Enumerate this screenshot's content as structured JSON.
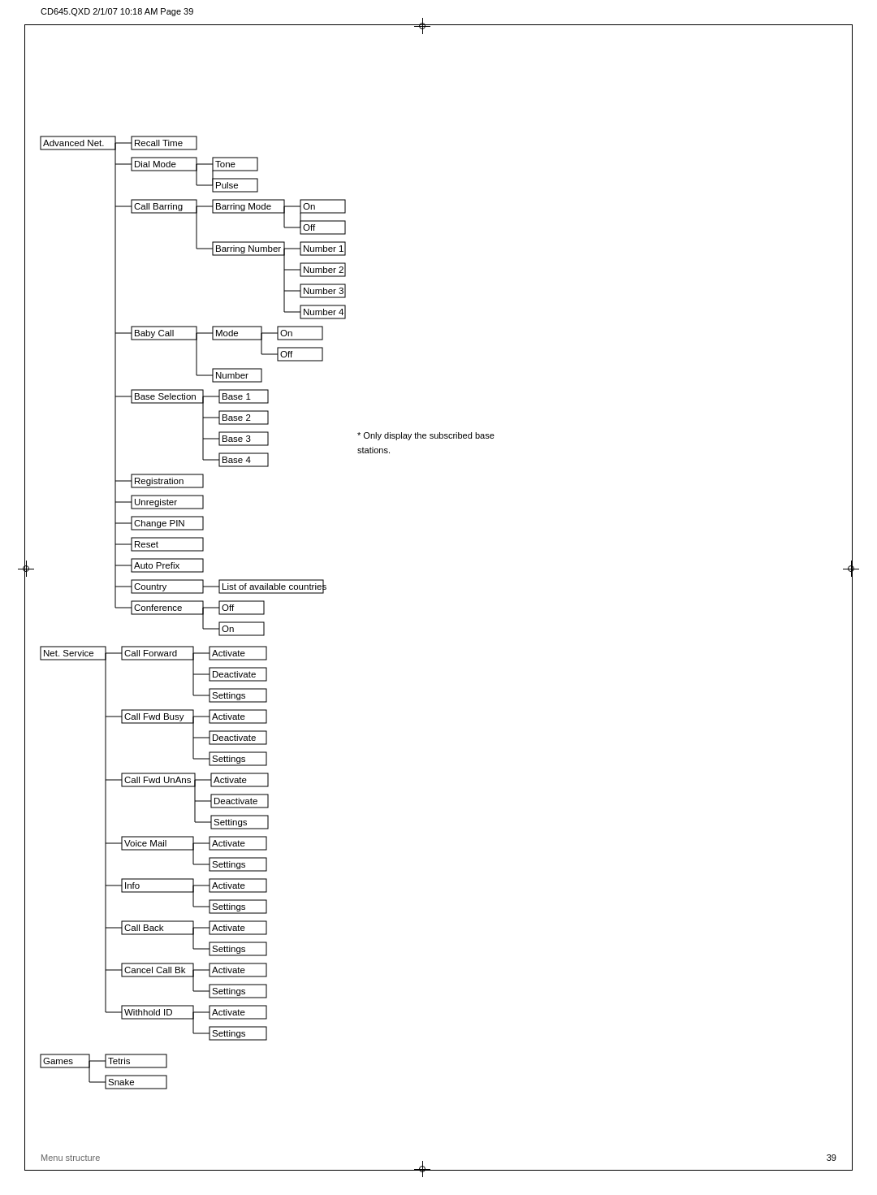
{
  "header": {
    "text": "CD645.QXD   2/1/07   10:18 AM   Page  39"
  },
  "footer": {
    "label": "Menu structure",
    "page_number": "39"
  },
  "note": "* Only display the subscribed base stations.",
  "tree": {
    "root1": {
      "label": "Advanced Net.",
      "children": [
        {
          "label": "Recall Time"
        },
        {
          "label": "Dial Mode",
          "children": [
            {
              "label": "Tone"
            },
            {
              "label": "Pulse"
            }
          ]
        },
        {
          "label": "Call Barring",
          "children": [
            {
              "label": "Barring Mode",
              "children": [
                {
                  "label": "On"
                },
                {
                  "label": "Off"
                }
              ]
            },
            {
              "label": "Barring Number",
              "children": [
                {
                  "label": "Number 1"
                },
                {
                  "label": "Number 2"
                },
                {
                  "label": "Number 3"
                },
                {
                  "label": "Number 4"
                }
              ]
            }
          ]
        },
        {
          "label": "Baby Call",
          "children": [
            {
              "label": "Mode",
              "children": [
                {
                  "label": "On"
                },
                {
                  "label": "Off"
                }
              ]
            },
            {
              "label": "Number"
            }
          ]
        },
        {
          "label": "Base Selection",
          "children": [
            {
              "label": "Base 1"
            },
            {
              "label": "Base 2"
            },
            {
              "label": "Base 3"
            },
            {
              "label": "Base 4"
            }
          ]
        },
        {
          "label": "Registration"
        },
        {
          "label": "Unregister"
        },
        {
          "label": "Change PIN"
        },
        {
          "label": "Reset"
        },
        {
          "label": "Auto Prefix"
        },
        {
          "label": "Country",
          "children": [
            {
              "label": "List of available countries"
            }
          ]
        },
        {
          "label": "Conference",
          "children": [
            {
              "label": "Off"
            },
            {
              "label": "On"
            }
          ]
        }
      ]
    },
    "root2": {
      "label": "Net. Service",
      "children": [
        {
          "label": "Call Forward",
          "children": [
            {
              "label": "Activate"
            },
            {
              "label": "Deactivate"
            },
            {
              "label": "Settings"
            }
          ]
        },
        {
          "label": "Call Fwd Busy",
          "children": [
            {
              "label": "Activate"
            },
            {
              "label": "Deactivate"
            },
            {
              "label": "Settings"
            }
          ]
        },
        {
          "label": "Call Fwd UnAns",
          "children": [
            {
              "label": "Activate"
            },
            {
              "label": "Deactivate"
            },
            {
              "label": "Settings"
            }
          ]
        },
        {
          "label": "Voice Mail",
          "children": [
            {
              "label": "Activate"
            },
            {
              "label": "Settings"
            }
          ]
        },
        {
          "label": "Info",
          "children": [
            {
              "label": "Activate"
            },
            {
              "label": "Settings"
            }
          ]
        },
        {
          "label": "Call Back",
          "children": [
            {
              "label": "Activate"
            },
            {
              "label": "Settings"
            }
          ]
        },
        {
          "label": "Cancel Call Bk",
          "children": [
            {
              "label": "Activate"
            },
            {
              "label": "Settings"
            }
          ]
        },
        {
          "label": "Withhold ID",
          "children": [
            {
              "label": "Activate"
            },
            {
              "label": "Settings"
            }
          ]
        }
      ]
    },
    "root3": {
      "label": "Games",
      "children": [
        {
          "label": "Tetris"
        },
        {
          "label": "Snake"
        }
      ]
    }
  }
}
